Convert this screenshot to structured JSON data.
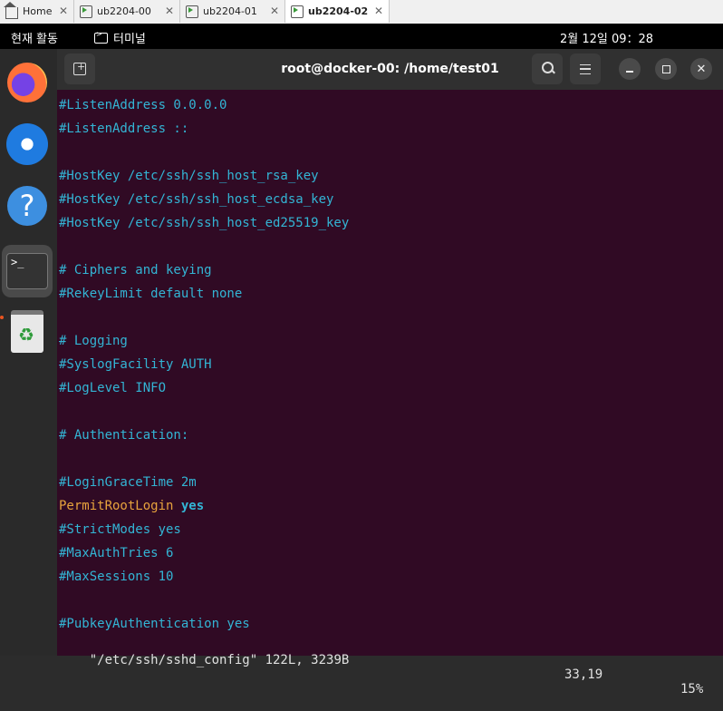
{
  "vm_tabs": [
    {
      "label": "Home",
      "icon": "home-icon",
      "active": false
    },
    {
      "label": "ub2204-00",
      "icon": "vm-icon",
      "active": false
    },
    {
      "label": "ub2204-01",
      "icon": "vm-icon",
      "active": false
    },
    {
      "label": "ub2204-02",
      "icon": "vm-icon",
      "active": true
    }
  ],
  "close_glyph": "✕",
  "topbar": {
    "activities": "현재 활동",
    "app_name": "터미널",
    "clock": "2월 12일  09：28"
  },
  "dock": {
    "help_glyph": "?",
    "terminal_glyph": ">_",
    "trash_glyph": "♻"
  },
  "terminal": {
    "title": "root@docker-00: /home/test01",
    "lines": [
      "#ListenAddress 0.0.0.0",
      "#ListenAddress ::",
      "",
      "#HostKey /etc/ssh/ssh_host_rsa_key",
      "#HostKey /etc/ssh/ssh_host_ecdsa_key",
      "#HostKey /etc/ssh/ssh_host_ed25519_key",
      "",
      "# Ciphers and keying",
      "#RekeyLimit default none",
      "",
      "# Logging",
      "#SyslogFacility AUTH",
      "#LogLevel INFO",
      "",
      "# Authentication:",
      "",
      "#LoginGraceTime 2m",
      "__PERMIT__",
      "#StrictModes yes",
      "#MaxAuthTries 6",
      "#MaxSessions 10",
      "",
      "#PubkeyAuthentication yes"
    ],
    "permit_key": "PermitRootLogin",
    "permit_val": "yes",
    "status": {
      "file": "\"/etc/ssh/sshd_config\" 122L, 3239B",
      "position": "33,19",
      "percent": "15%"
    }
  },
  "colors": {
    "terminal_bg": "#300a24",
    "comment": "#33b5d5",
    "keyword": "#e8a33d"
  }
}
